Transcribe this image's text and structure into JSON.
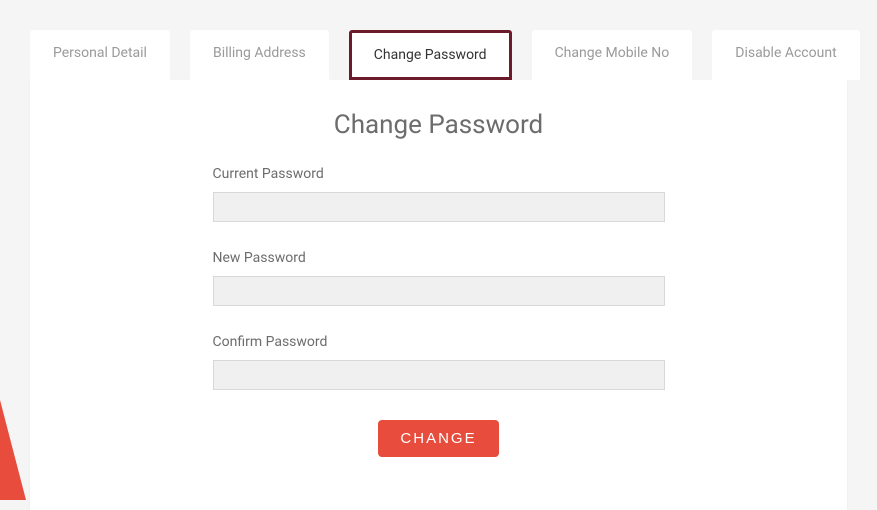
{
  "tabs": {
    "personal_detail": "Personal Detail",
    "billing_address": "Billing Address",
    "change_password": "Change Password",
    "change_mobile_no": "Change Mobile No",
    "disable_account": "Disable Account"
  },
  "panel": {
    "title": "Change Password",
    "fields": {
      "current_password": {
        "label": "Current Password",
        "value": ""
      },
      "new_password": {
        "label": "New Password",
        "value": ""
      },
      "confirm_password": {
        "label": "Confirm Password",
        "value": ""
      }
    },
    "submit_label": "CHANGE"
  }
}
